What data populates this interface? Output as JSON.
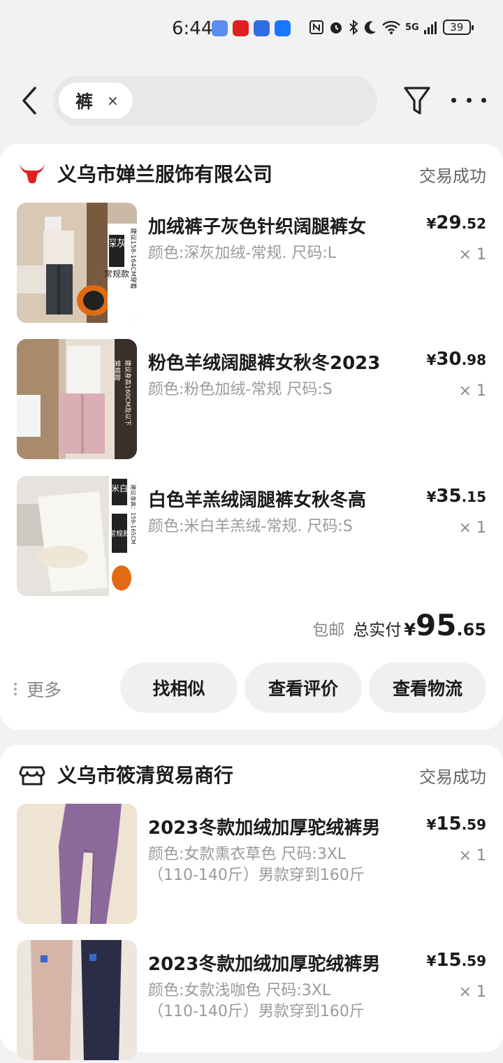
{
  "status_bar": {
    "time": "6:44",
    "network": "5G",
    "battery": "39"
  },
  "search": {
    "chip_label": "裤",
    "chip_close": "×"
  },
  "orders": [
    {
      "shop_name": "义乌市婵兰服饰有限公司",
      "status": "交易成功",
      "items": [
        {
          "title": "加绒裤子灰色针织阔腿裤女",
          "spec": "颜色:深灰加绒-常规. 尺码:L",
          "price_yen": "¥",
          "price_int": "29",
          "price_cents": ".52",
          "qty": "× 1"
        },
        {
          "title": "粉色羊绒阔腿裤女秋冬2023",
          "spec": "颜色:粉色加绒-常规 尺码:S",
          "price_yen": "¥",
          "price_int": "30",
          "price_cents": ".98",
          "qty": "× 1"
        },
        {
          "title": "白色羊羔绒阔腿裤女秋冬高",
          "spec": "颜色:米白羊羔绒-常规. 尺码:S",
          "price_yen": "¥",
          "price_int": "35",
          "price_cents": ".15",
          "qty": "× 1"
        }
      ],
      "shipping": "包邮",
      "total_label": "总实付",
      "total_yen": "¥",
      "total_int": "95",
      "total_cents": ".65",
      "more_label": "更多",
      "actions": [
        "找相似",
        "查看评价",
        "查看物流"
      ]
    },
    {
      "shop_name": "义乌市筱清贸易商行",
      "status": "交易成功",
      "items": [
        {
          "title": "2023冬款加绒加厚驼绒裤男",
          "spec": "颜色:女款熏衣草色 尺码:3XL",
          "spec2": "（110-140斤）男款穿到160斤",
          "price_yen": "¥",
          "price_int": "15",
          "price_cents": ".59",
          "qty": "× 1"
        },
        {
          "title": "2023冬款加绒加厚驼绒裤男",
          "spec": "颜色:女款浅咖色 尺码:3XL",
          "spec2": "（110-140斤）男款穿到160斤",
          "price_yen": "¥",
          "price_int": "15",
          "price_cents": ".59",
          "qty": "× 1"
        }
      ]
    }
  ],
  "thumb_labels": {
    "t1_tag": "深灰",
    "t1_tag2": "常规款",
    "t1_note": "建议158-164CM穿着",
    "t2_tag": "常规款",
    "t2_note": "建议身高160CM及以下",
    "t3_tag": "米白",
    "t3_tag2": "常规款",
    "t3_note": "建议身高：159-165CM"
  },
  "colors": {
    "accent_red": "#e02020",
    "card_bg": "#ffffff",
    "page_bg": "#f2f2f2"
  }
}
